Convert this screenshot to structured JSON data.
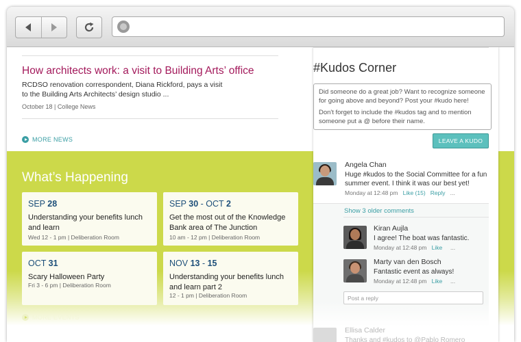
{
  "browser": {
    "url": ""
  },
  "news": {
    "title": "How architects work: a visit to Building Arts’ office",
    "body": "RCDSO renovation correspondent, Diana Rickford, pays a visit to the Building Arts Architects’ design studio ...",
    "meta": "October 18  |  College News",
    "more_label": "MORE NEWS"
  },
  "events": {
    "title": "What’s Happening",
    "more_label": "MORE EVENTS",
    "cards": [
      {
        "month": "SEP",
        "day": "28",
        "title": "Understanding your benefits lunch and learn",
        "meta": "Wed 12 - 1 pm | Deliberation Room"
      },
      {
        "month": "SEP",
        "day": "30",
        "range_sep": " - ",
        "month2": "OCT",
        "day2": "2",
        "title": "Get the most out of the Knowledge Bank area of The Junction",
        "meta": "10 am - 12 pm | Deliberation Room"
      },
      {
        "month": "OCT",
        "day": "31",
        "title": "Scary Halloween Party",
        "meta": "Fri 3 - 6 pm | Deliberation Room"
      },
      {
        "month": "NOV",
        "day": "13",
        "range_sep": " - ",
        "day2": "15",
        "title": "Understanding your benefits lunch and learn part 2",
        "meta": "12 - 1 pm | Deliberation Room"
      }
    ]
  },
  "kudos": {
    "title": "#Kudos Corner",
    "intro1": "Did someone do a great job? Want to recognize someone for going above and beyond? Post your #kudo here!",
    "intro2": "Don't forget to include the #kudos tag and to mention someone put a @ before their name.",
    "button_label": "LEAVE A KUDO",
    "post": {
      "author": "Angela Chan",
      "text": "Huge #kudos to the Social Committee for a fun summer event. I think it was our best yet!",
      "time": "Monday at 12:48 pm",
      "like": "Like (15)",
      "reply": "Reply",
      "more": "..."
    },
    "show_older": "Show 3 older comments",
    "replies": [
      {
        "author": "Kiran Aujla",
        "text": "I agree! The boat was fantastic.",
        "time": "Monday at 12:48 pm",
        "like": "Like",
        "more": "..."
      },
      {
        "author": "Marty van den Bosch",
        "text": "Fantastic event as always!",
        "time": "Monday at 12:48 pm",
        "like": "Like",
        "more": "..."
      }
    ],
    "reply_placeholder": "Post a reply",
    "next_post": {
      "author": "Ellisa Calder",
      "text": "Thanks and #kudos to @Pablo Romero @Sarah"
    }
  },
  "colors": {
    "accent_teal": "#3a9ea4",
    "lime": "#ccd94a",
    "news_title": "#a3195b",
    "date_blue": "#1d4f7a"
  }
}
